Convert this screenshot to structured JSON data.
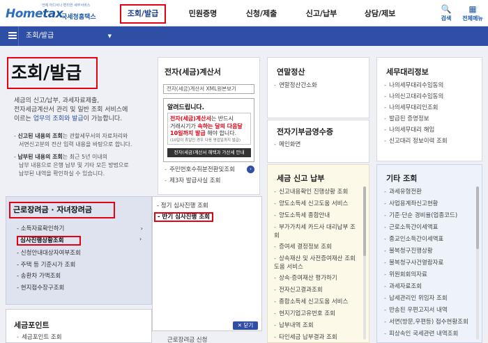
{
  "header": {
    "logo_small": "언제 어디서나 편리한 세무서비스",
    "logo_home": "Home",
    "logo_tax": "tax",
    "logo_kr": "국세청홈택스",
    "gnb": [
      "조회/발급",
      "민원증명",
      "신청/제출",
      "신고/납부",
      "상담/제보"
    ],
    "search_label": "검색",
    "menu_label": "전체메뉴"
  },
  "navbar": {
    "breadcrumb": "조회/발급"
  },
  "intro": {
    "title": "조회/발급",
    "desc_1": "세금의 신고/납부, 과세자료제출,",
    "desc_2": "전자세금계산서 관리 및 일반 조회 서비스에",
    "desc_3_pre": "이르는 ",
    "desc_3_hl": "업무의 조회와 발급",
    "desc_3_post": "이 가능합니다.",
    "note1_b": "신고된 내용의 조회",
    "note1": "는 관할세무서의 자료처리와",
    "note1_2": "서면신고분의 전산 입력 내용을 바탕으로 합니다.",
    "note2_b": "납부된 내용의 조회",
    "note2": "는 최근 5년 이내의",
    "note2_2": "납부 내용으로 은행 납부 및 기타 모든 방법으로",
    "note2_3": "납부된 내역을 확인하실 수 있습니다."
  },
  "left_panel": {
    "title": "근로장려금 · 자녀장려금",
    "items": [
      "소득자료확인하기",
      "심사진행상황조회",
      "신청안내대상자여부조회",
      "주택 등 기준시가 조회",
      "송환차 가액조회",
      "현지접수장구조회"
    ],
    "tax_point_title": "세금포인트",
    "tax_point_item": "세금포인트 조회"
  },
  "flyout": {
    "items": [
      "정기 심사진행 조회",
      "반기 심사진행 조회"
    ],
    "close_label": "닫기",
    "bottom_item": "근로장려금 신청"
  },
  "cards": {
    "einvoice": {
      "title": "전자(세금)계산서",
      "select_value": "전자(세금)계산서 XML원본보기",
      "notice_title": "알려드립니다.",
      "notice_red1": "전자(세금)계산서",
      "notice_t1": "는 반드시",
      "notice_t2": "거래시기가 ",
      "notice_red2": "속하는 달의 다음달",
      "notice_red3": "10일까지 발급",
      "notice_t3": " 해야 합니다.",
      "notice_small": "(10일이 휴일인 경우 다음 영업일까지 발급)",
      "notice_bar": "전자(세금)계산서 혜택과 가산세 안내",
      "items": [
        "주민번호수취분전환및조회",
        "제3자 발급사실 조회"
      ]
    },
    "yearend": {
      "title": "연말정산",
      "items": [
        "연말정산간소화"
      ]
    },
    "donation": {
      "title": "전자기부금영수증",
      "items": [
        "메인화면"
      ]
    },
    "agent": {
      "title": "세무대리정보",
      "items": [
        "나의세무대리수임동의",
        "나의신고대리수임동의",
        "나의세무대리인조회",
        "발급된 증명정보",
        "나의세무대리 해임",
        "신고대리 정보이력 조회"
      ]
    },
    "taxfiling": {
      "title": "세금 신고 납부",
      "items": [
        "신고내용확인 진행상황 조회",
        "양도소득세 신고도움 서비스",
        "양도소득세 종합안내",
        "부가가치세 카드사 대리납부 조회",
        "증여세 결정정보 조회",
        "상속재산 및 사전증여재산 조회 도움 서비스",
        "상속·증여재산 평가하기",
        "전자신고결과조회",
        "종합소득세 신고도움 서비스",
        "현지기업고유번호 조회",
        "납부내역 조회",
        "타인세금 납부결과 조회"
      ]
    },
    "other": {
      "title": "기타 조회",
      "items": [
        "과세유형전환",
        "사업용계좌신고현황",
        "기준·단순 경비율(업종코드)",
        "근로소득간이세액표",
        "종교인소득간이세액표",
        "불복청구진행상황",
        "불복청구사건열람자료",
        "위원회회의자료",
        "과세자료조회",
        "납세관리인 위임자 조회",
        "반송된 우편고지서 내역",
        "서면(방문,우편등) 접수현황조회",
        "피상속인 국세관련 내역조회"
      ]
    }
  }
}
